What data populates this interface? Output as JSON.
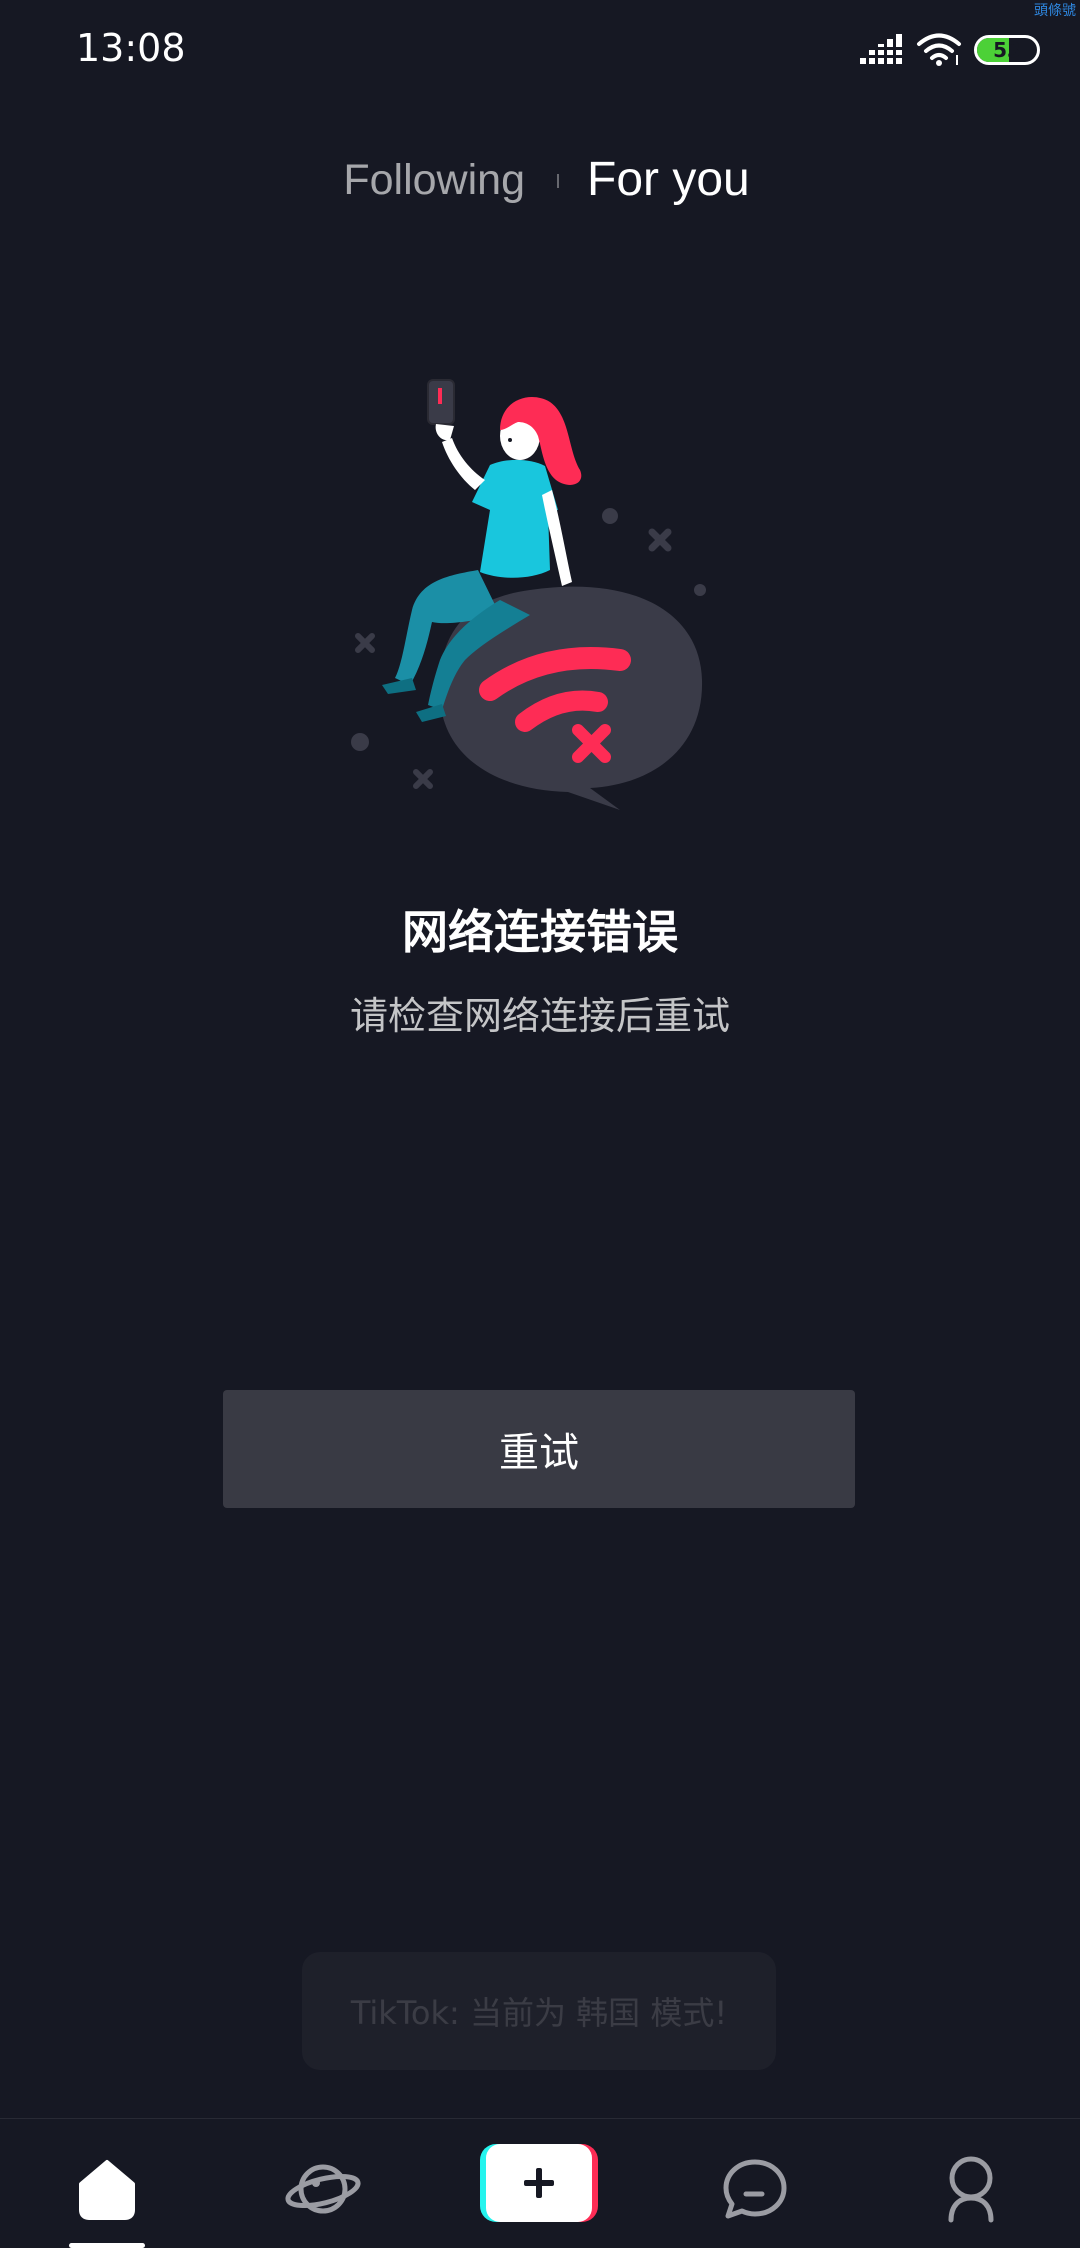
{
  "status_bar": {
    "time": "13:08",
    "battery_level": "53",
    "battery_fraction": 0.53,
    "watermark": "頭條號",
    "icons": [
      "signal-icon",
      "wifi-icon",
      "battery-icon"
    ]
  },
  "top_tabs": {
    "following": "Following",
    "for_you": "For you",
    "active": "for_you"
  },
  "error": {
    "title": "网络连接错误",
    "subtitle": "请检查网络连接后重试",
    "illustration": "girl-sitting-on-no-wifi-bubble-illustration"
  },
  "retry_button": {
    "label": "重试"
  },
  "toast": {
    "text": "TikTok: 当前为 韩国 模式!"
  },
  "bottom_nav": {
    "items": [
      {
        "name": "home",
        "icon": "home-icon",
        "active": true
      },
      {
        "name": "discover",
        "icon": "planet-icon",
        "active": false
      },
      {
        "name": "create",
        "icon": "plus-icon",
        "active": false
      },
      {
        "name": "inbox",
        "icon": "message-bubble-icon",
        "active": false
      },
      {
        "name": "profile",
        "icon": "person-icon",
        "active": false
      }
    ]
  },
  "colors": {
    "background": "#161823",
    "button_bg": "#393a44",
    "accent_red": "#fe2c55",
    "accent_cyan": "#25f4ee",
    "battery_green": "#4cd137"
  }
}
